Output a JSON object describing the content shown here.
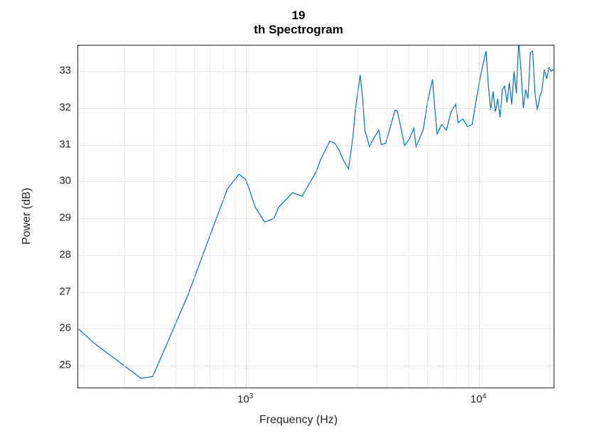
{
  "chart_data": {
    "type": "line",
    "title": "19\nth Spectrogram",
    "xlabel": "Frequency (Hz)",
    "ylabel": "Power (dB)",
    "xscale": "log",
    "xlim_log10": [
      2.28,
      4.32
    ],
    "ylim": [
      24.4,
      33.7
    ],
    "y_ticks": [
      25,
      26,
      27,
      28,
      29,
      30,
      31,
      32,
      33
    ],
    "x_major_ticks_log10": [
      3,
      4
    ],
    "x_major_tick_labels": [
      "10^3",
      "10^4"
    ],
    "x_minor_ticks_log10": [
      2.301,
      2.477,
      2.602,
      2.699,
      2.778,
      2.845,
      2.903,
      2.954,
      3.301,
      3.477,
      3.602,
      3.699,
      3.778,
      3.845,
      3.903,
      3.954,
      4.301
    ],
    "series": [
      {
        "name": "power",
        "color": "#0072BD",
        "points": [
          [
            2.28,
            26.0
          ],
          [
            2.35,
            25.6
          ],
          [
            2.55,
            24.65
          ],
          [
            2.6,
            24.7
          ],
          [
            2.75,
            26.9
          ],
          [
            2.92,
            29.8
          ],
          [
            2.97,
            30.2
          ],
          [
            3.0,
            30.05
          ],
          [
            3.04,
            29.3
          ],
          [
            3.08,
            28.9
          ],
          [
            3.12,
            29.0
          ],
          [
            3.14,
            29.3
          ],
          [
            3.2,
            29.7
          ],
          [
            3.24,
            29.6
          ],
          [
            3.3,
            30.25
          ],
          [
            3.32,
            30.6
          ],
          [
            3.36,
            31.1
          ],
          [
            3.38,
            31.05
          ],
          [
            3.4,
            30.85
          ],
          [
            3.42,
            30.55
          ],
          [
            3.44,
            30.35
          ],
          [
            3.45,
            30.8
          ],
          [
            3.46,
            31.3
          ],
          [
            3.47,
            32.0
          ],
          [
            3.49,
            32.9
          ],
          [
            3.5,
            32.3
          ],
          [
            3.51,
            31.4
          ],
          [
            3.53,
            30.95
          ],
          [
            3.55,
            31.2
          ],
          [
            3.57,
            31.4
          ],
          [
            3.58,
            31.0
          ],
          [
            3.6,
            31.05
          ],
          [
            3.62,
            31.5
          ],
          [
            3.64,
            31.95
          ],
          [
            3.65,
            31.9
          ],
          [
            3.67,
            31.3
          ],
          [
            3.68,
            30.98
          ],
          [
            3.7,
            31.15
          ],
          [
            3.72,
            31.45
          ],
          [
            3.73,
            30.95
          ],
          [
            3.76,
            31.4
          ],
          [
            3.78,
            32.2
          ],
          [
            3.8,
            32.78
          ],
          [
            3.81,
            32.0
          ],
          [
            3.82,
            31.3
          ],
          [
            3.84,
            31.55
          ],
          [
            3.86,
            31.4
          ],
          [
            3.88,
            31.9
          ],
          [
            3.9,
            32.1
          ],
          [
            3.91,
            31.6
          ],
          [
            3.93,
            31.7
          ],
          [
            3.95,
            31.5
          ],
          [
            3.97,
            31.55
          ],
          [
            3.99,
            32.3
          ],
          [
            4.01,
            33.0
          ],
          [
            4.03,
            33.55
          ],
          [
            4.04,
            32.6
          ],
          [
            4.05,
            31.95
          ],
          [
            4.06,
            32.45
          ],
          [
            4.07,
            31.9
          ],
          [
            4.08,
            32.25
          ],
          [
            4.09,
            31.75
          ],
          [
            4.1,
            32.5
          ],
          [
            4.11,
            32.6
          ],
          [
            4.12,
            32.15
          ],
          [
            4.13,
            32.7
          ],
          [
            4.14,
            32.1
          ],
          [
            4.15,
            33.0
          ],
          [
            4.16,
            32.4
          ],
          [
            4.17,
            33.8
          ],
          [
            4.18,
            33.0
          ],
          [
            4.19,
            32.0
          ],
          [
            4.2,
            32.5
          ],
          [
            4.21,
            32.25
          ],
          [
            4.22,
            33.5
          ],
          [
            4.23,
            33.55
          ],
          [
            4.24,
            32.4
          ],
          [
            4.25,
            31.95
          ],
          [
            4.26,
            32.3
          ],
          [
            4.27,
            32.48
          ],
          [
            4.28,
            33.05
          ],
          [
            4.29,
            32.8
          ],
          [
            4.3,
            33.1
          ],
          [
            4.31,
            33.0
          ],
          [
            4.32,
            33.05
          ]
        ]
      }
    ]
  }
}
